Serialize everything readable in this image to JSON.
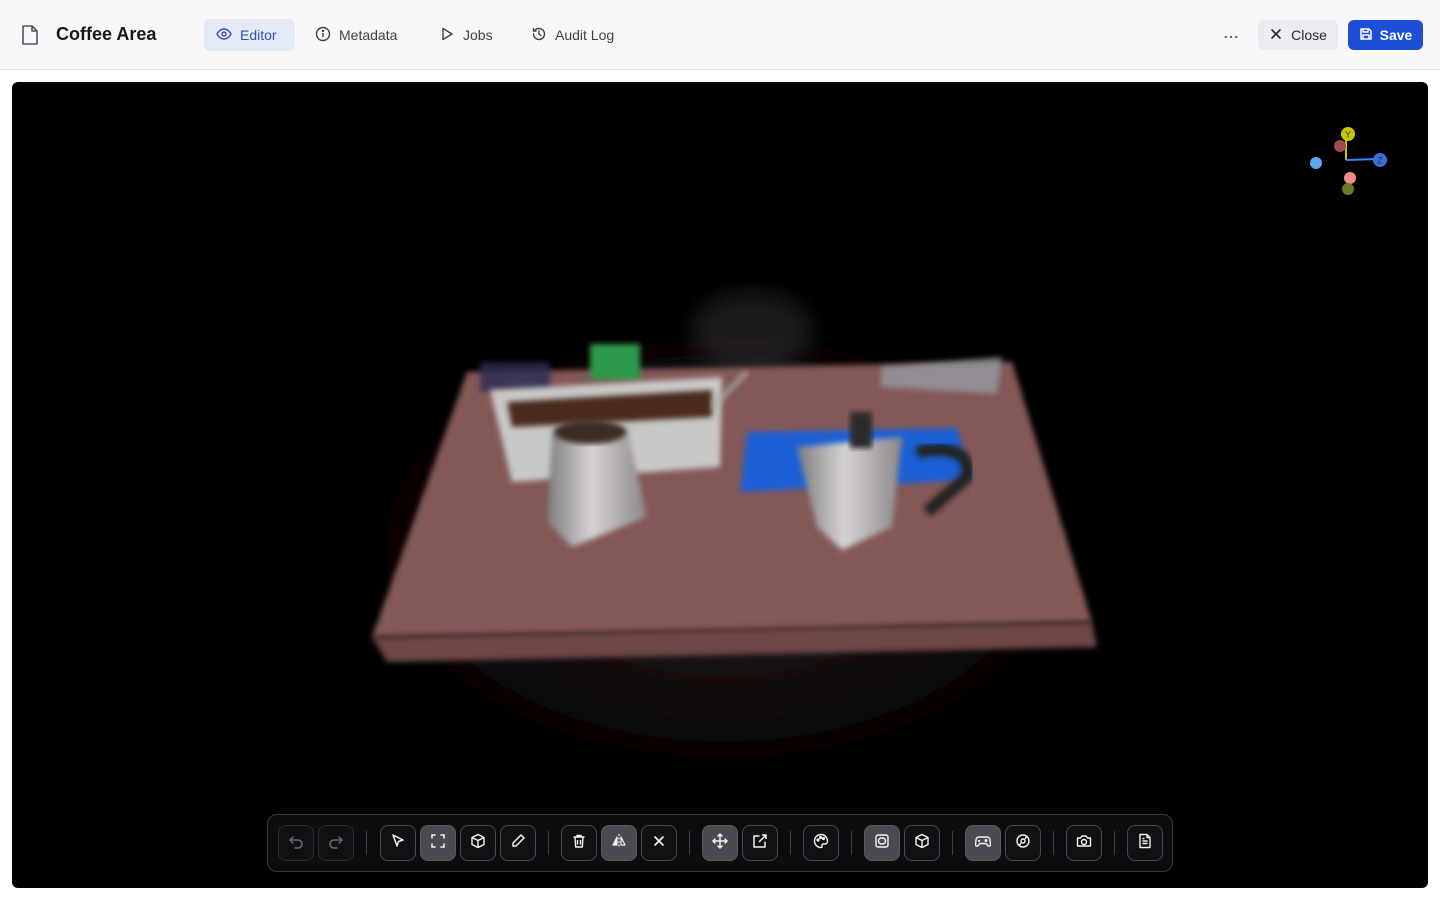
{
  "header": {
    "title": "Coffee Area",
    "tabs": [
      {
        "label": "Editor",
        "icon": "eye-icon",
        "active": true
      },
      {
        "label": "Metadata",
        "icon": "info-icon",
        "active": false
      },
      {
        "label": "Jobs",
        "icon": "play-icon",
        "active": false
      },
      {
        "label": "Audit Log",
        "icon": "history-icon",
        "active": false
      }
    ],
    "close_label": "Close",
    "save_label": "Save"
  },
  "gizmo": {
    "y_label": "Y",
    "z_label": "Z"
  },
  "toolbar": {
    "buttons": [
      "undo-icon",
      "redo-icon",
      "select-arrow-icon",
      "box-select-icon",
      "cube-select-icon",
      "brush-icon",
      "delete-icon",
      "flip-icon",
      "close-icon",
      "move-icon",
      "export-icon",
      "palette-icon",
      "frame-icon",
      "cube-icon",
      "gamepad-icon",
      "orbit-icon",
      "camera-icon",
      "document-icon"
    ]
  },
  "colors": {
    "accent": "#1d4ed8",
    "active_tab_bg": "#e4e9f6",
    "active_tab_text": "#3451b2",
    "viewport_bg": "#000000"
  }
}
